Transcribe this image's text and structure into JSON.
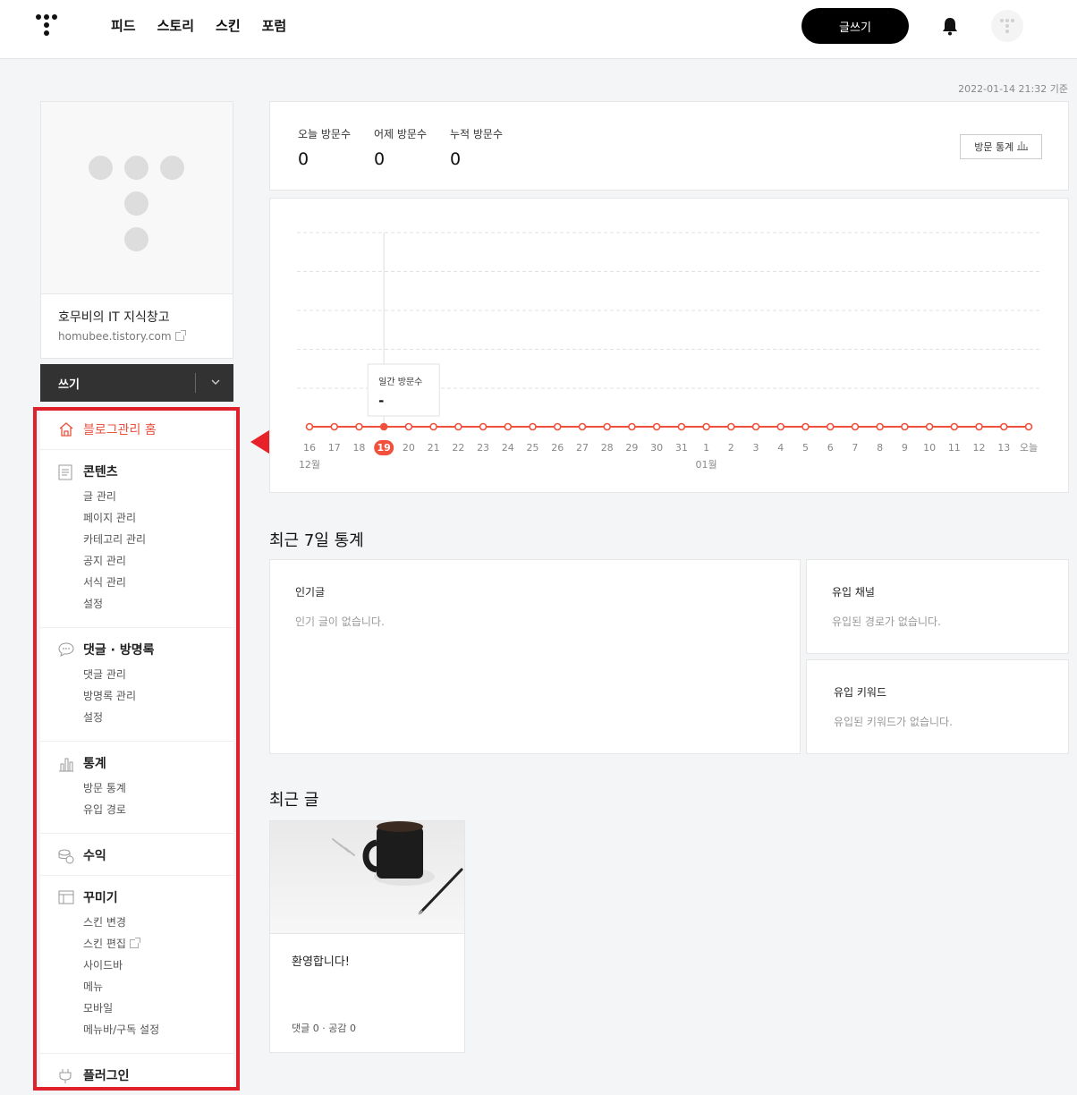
{
  "nav": {
    "items": [
      "피드",
      "스토리",
      "스킨",
      "포럼"
    ],
    "write_button": "글쓰기"
  },
  "timestamp": "2022-01-14 21:32 기준",
  "profile": {
    "blog_name": "호무비의 IT 지식창고",
    "blog_url": "homubee.tistory.com"
  },
  "write_bar": {
    "label": "쓰기"
  },
  "menu": {
    "home": "블로그관리 홈",
    "groups": [
      {
        "title": "콘텐츠",
        "icon": "document-icon",
        "items": [
          "글 관리",
          "페이지 관리",
          "카테고리 관리",
          "공지 관리",
          "서식 관리",
          "설정"
        ]
      },
      {
        "title": "댓글 · 방명록",
        "icon": "speech-bubble-icon",
        "items": [
          "댓글 관리",
          "방명록 관리",
          "설정"
        ]
      },
      {
        "title": "통계",
        "icon": "bar-chart-icon",
        "items": [
          "방문 통계",
          "유입 경로"
        ]
      },
      {
        "title": "수익",
        "icon": "coins-icon",
        "items": []
      },
      {
        "title": "꾸미기",
        "icon": "layout-icon",
        "items": [
          "스킨 변경",
          "스킨 편집",
          "사이드바",
          "메뉴",
          "모바일",
          "메뉴바/구독 설정"
        ]
      },
      {
        "title": "플러그인",
        "icon": "plug-icon",
        "items": []
      }
    ]
  },
  "stats": {
    "today_label": "오늘 방문수",
    "today_value": "0",
    "yesterday_label": "어제 방문수",
    "yesterday_value": "0",
    "total_label": "누적 방문수",
    "total_value": "0",
    "button": "방문 통계"
  },
  "chart_data": {
    "type": "line",
    "x": [
      "16",
      "17",
      "18",
      "19",
      "20",
      "21",
      "22",
      "23",
      "24",
      "25",
      "26",
      "27",
      "28",
      "29",
      "30",
      "31",
      "1",
      "2",
      "3",
      "4",
      "5",
      "6",
      "7",
      "8",
      "9",
      "10",
      "11",
      "12",
      "13",
      "오늘"
    ],
    "month_labels": [
      {
        "label": "12월",
        "at": "16"
      },
      {
        "label": "01월",
        "at": "1"
      }
    ],
    "series": [
      {
        "values": [
          0,
          0,
          0,
          0,
          0,
          0,
          0,
          0,
          0,
          0,
          0,
          0,
          0,
          0,
          0,
          0,
          0,
          0,
          0,
          0,
          0,
          0,
          0,
          0,
          0,
          0,
          0,
          0,
          0,
          0
        ]
      }
    ],
    "selected": "19",
    "tooltip": {
      "title": "일간 방문수",
      "value": "-"
    },
    "grid": true,
    "color": "#f0503c"
  },
  "recent7": {
    "title": "최근 7일 통계",
    "popular": {
      "title": "인기글",
      "empty": "인기 글이 없습니다."
    },
    "channel": {
      "title": "유입 채널",
      "empty": "유입된 경로가 없습니다."
    },
    "keyword": {
      "title": "유입 키워드",
      "empty": "유입된 키워드가 없습니다."
    }
  },
  "recent_posts": {
    "title": "최근 글",
    "post": {
      "title": "환영합니다!",
      "meta": "댓글 0 · 공감 0"
    }
  }
}
